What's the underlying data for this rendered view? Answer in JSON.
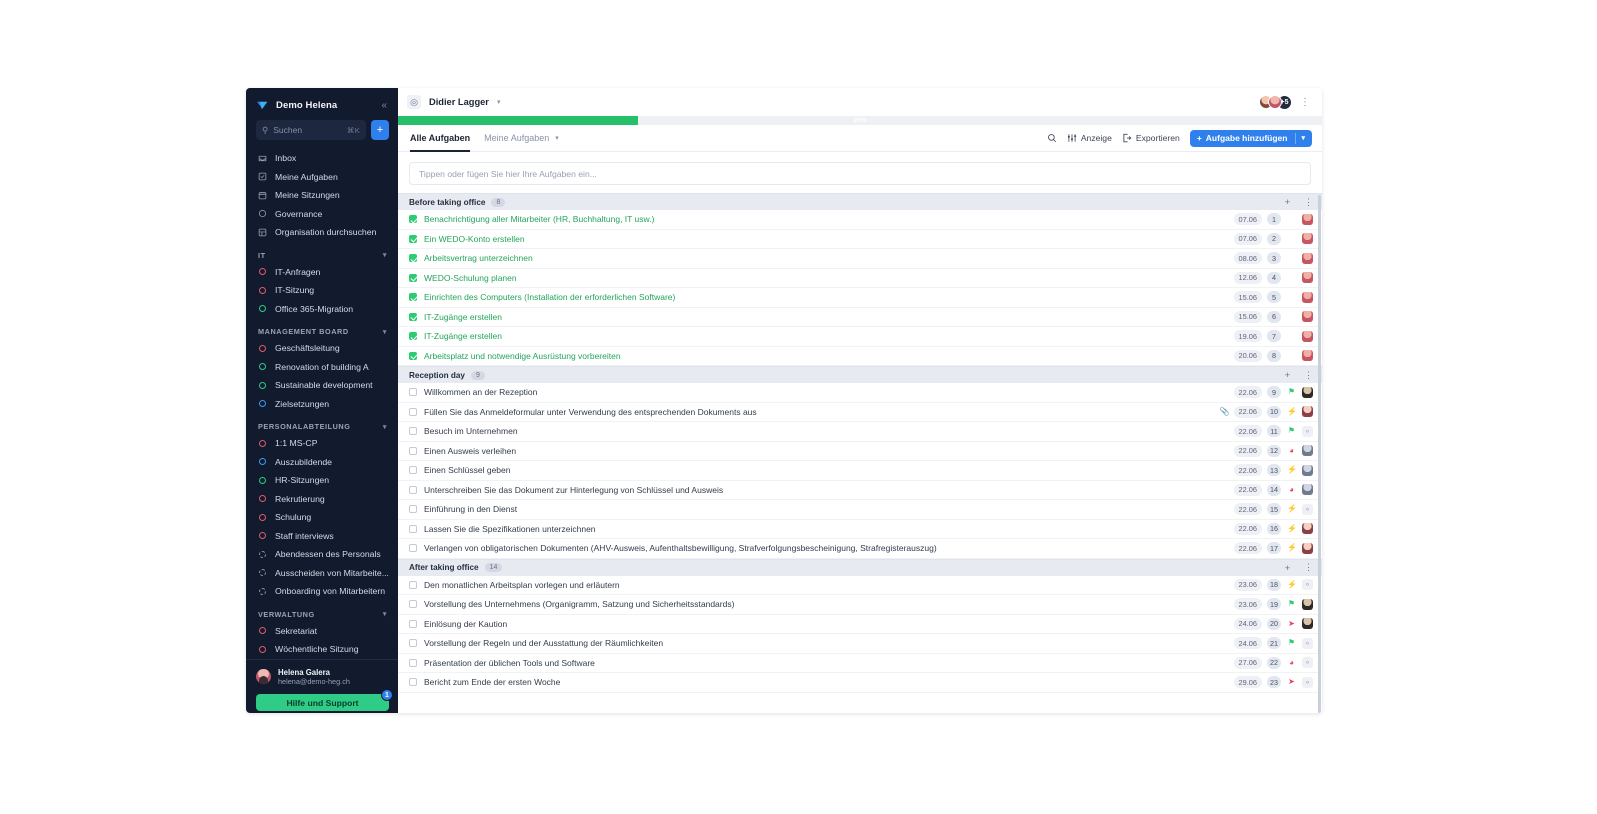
{
  "sidebar": {
    "brand": "Demo Helena",
    "collapse_icon": "chevrons-left-icon",
    "search": {
      "placeholder": "Suchen",
      "shortcut": "⌘K",
      "add_label": "+"
    },
    "nav": [
      {
        "label": "Inbox",
        "icon": "inbox-icon"
      },
      {
        "label": "Meine Aufgaben",
        "icon": "check-square-icon"
      },
      {
        "label": "Meine Sitzungen",
        "icon": "calendar-icon"
      },
      {
        "label": "Governance",
        "icon": "circle-icon"
      },
      {
        "label": "Organisation durchsuchen",
        "icon": "grid-icon"
      }
    ],
    "groups": [
      {
        "title": "IT",
        "items": [
          {
            "label": "IT-Anfragen",
            "color": "#e05a6e",
            "style": "solid"
          },
          {
            "label": "IT-Sitzung",
            "color": "#e05a6e",
            "style": "solid"
          },
          {
            "label": "Office 365-Migration",
            "color": "#2ecc87",
            "style": "solid"
          }
        ]
      },
      {
        "title": "MANAGEMENT BOARD",
        "items": [
          {
            "label": "Geschäftsleitung",
            "color": "#e05a6e",
            "style": "solid"
          },
          {
            "label": "Renovation of building A",
            "color": "#2ecc87",
            "style": "solid"
          },
          {
            "label": "Sustainable development",
            "color": "#2ecc87",
            "style": "solid"
          },
          {
            "label": "Zielsetzungen",
            "color": "#3b9bf0",
            "style": "solid"
          }
        ]
      },
      {
        "title": "PERSONALABTEILUNG",
        "items": [
          {
            "label": "1:1 MS-CP",
            "color": "#e05a6e",
            "style": "solid"
          },
          {
            "label": "Auszubildende",
            "color": "#3b9bf0",
            "style": "solid"
          },
          {
            "label": "HR-Sitzungen",
            "color": "#2ecc87",
            "style": "solid"
          },
          {
            "label": "Rekrutierung",
            "color": "#e05a6e",
            "style": "solid"
          },
          {
            "label": "Schulung",
            "color": "#e05a6e",
            "style": "solid"
          },
          {
            "label": "Staff interviews",
            "color": "#e05a6e",
            "style": "solid"
          },
          {
            "label": "Abendessen des Personals",
            "color": "#8b94a8",
            "style": "dashed"
          },
          {
            "label": "Ausscheiden von Mitarbeite...",
            "color": "#8b94a8",
            "style": "dashed"
          },
          {
            "label": "Onboarding von Mitarbeitern",
            "color": "#8b94a8",
            "style": "dashed"
          }
        ]
      },
      {
        "title": "VERWALTUNG",
        "items": [
          {
            "label": "Sekretariat",
            "color": "#e05a6e",
            "style": "solid"
          },
          {
            "label": "Wöchentliche Sitzung",
            "color": "#e05a6e",
            "style": "solid"
          }
        ]
      }
    ],
    "user": {
      "name": "Helena Galera",
      "email": "helena@demo-heg.ch"
    },
    "help": {
      "label": "Hilfe und Support",
      "badge": "1"
    }
  },
  "topbar": {
    "breadcrumb_icon": "target-icon",
    "breadcrumb": "Didier Lagger",
    "breadcrumb_chevron": "chevron-down-icon",
    "avatar_overflow": "+5",
    "menu_icon": "kebab-menu-icon"
  },
  "progress": {
    "percent_label": "26%",
    "percent": 26,
    "color": "#27c06a"
  },
  "tabs": [
    {
      "label": "Alle Aufgaben",
      "active": true
    },
    {
      "label": "Meine Aufgaben",
      "active": false
    }
  ],
  "toolbar": {
    "search_icon": "search-icon",
    "view_label": "Anzeige",
    "view_icon": "sliders-icon",
    "export_label": "Exportieren",
    "export_icon": "export-icon",
    "add_task_label": "Aufgabe hinzufügen",
    "add_task_plus": "+",
    "add_task_chevron": "chevron-down-icon"
  },
  "quick_add": {
    "placeholder": "Tippen oder fügen Sie hier Ihre Aufgaben ein..."
  },
  "sections": [
    {
      "title": "Before taking office",
      "count": "8",
      "add_icon": "plus-icon",
      "menu_icon": "kebab-menu-icon",
      "rows": [
        {
          "done": true,
          "title": "Benachrichtigung aller Mitarbeiter (HR, Buchhaltung, IT usw.)",
          "due": "07.06",
          "index": "1",
          "priority": "",
          "priority_color": "",
          "avatar": "p1",
          "clip": false
        },
        {
          "done": true,
          "title": "Ein WEDO-Konto erstellen",
          "due": "07.06",
          "index": "2",
          "priority": "",
          "priority_color": "",
          "avatar": "p1",
          "clip": false
        },
        {
          "done": true,
          "title": "Arbeitsvertrag unterzeichnen",
          "due": "08.06",
          "index": "3",
          "priority": "",
          "priority_color": "",
          "avatar": "p1",
          "clip": false
        },
        {
          "done": true,
          "title": "WEDO-Schulung planen",
          "due": "12.06",
          "index": "4",
          "priority": "",
          "priority_color": "",
          "avatar": "p1",
          "clip": false
        },
        {
          "done": true,
          "title": "Einrichten des Computers (Installation der erforderlichen Software)",
          "due": "15.06",
          "index": "5",
          "priority": "",
          "priority_color": "",
          "avatar": "p1",
          "clip": false
        },
        {
          "done": true,
          "title": "IT-Zugänge erstellen",
          "due": "15.06",
          "index": "6",
          "priority": "",
          "priority_color": "",
          "avatar": "p1",
          "clip": false
        },
        {
          "done": true,
          "title": "IT-Zugänge erstellen",
          "due": "19.06",
          "index": "7",
          "priority": "",
          "priority_color": "",
          "avatar": "p1",
          "clip": false
        },
        {
          "done": true,
          "title": "Arbeitsplatz und notwendige Ausrüstung vorbereiten",
          "due": "20.06",
          "index": "8",
          "priority": "",
          "priority_color": "",
          "avatar": "p1",
          "clip": false
        }
      ]
    },
    {
      "title": "Reception day",
      "count": "9",
      "add_icon": "plus-icon",
      "menu_icon": "kebab-menu-icon",
      "rows": [
        {
          "done": false,
          "title": "Willkommen an der Rezeption",
          "due": "22.06",
          "index": "9",
          "priority": "⚑",
          "priority_color": "#2ecc71",
          "avatar": "p5",
          "clip": false
        },
        {
          "done": false,
          "title": "Füllen Sie das Anmeldeformular unter Verwendung des entsprechenden Dokuments aus",
          "due": "22.06",
          "index": "10",
          "priority": "⚡",
          "priority_color": "#e8425a",
          "avatar": "p4",
          "clip": true
        },
        {
          "done": false,
          "title": "Besuch im Unternehmen",
          "due": "22.06",
          "index": "11",
          "priority": "⚑",
          "priority_color": "#2ecc71",
          "avatar": "ph",
          "clip": false
        },
        {
          "done": false,
          "title": "Einen Ausweis verleihen",
          "due": "22.06",
          "index": "12",
          "priority": "◕",
          "priority_color": "#e8425a",
          "avatar": "p3",
          "clip": false
        },
        {
          "done": false,
          "title": "Einen Schlüssel geben",
          "due": "22.06",
          "index": "13",
          "priority": "⚡",
          "priority_color": "#e8425a",
          "avatar": "p3",
          "clip": false
        },
        {
          "done": false,
          "title": "Unterschreiben Sie das Dokument zur Hinterlegung von Schlüssel und Ausweis",
          "due": "22.06",
          "index": "14",
          "priority": "◕",
          "priority_color": "#e8425a",
          "avatar": "p3",
          "clip": false
        },
        {
          "done": false,
          "title": "Einführung in den Dienst",
          "due": "22.06",
          "index": "15",
          "priority": "⚡",
          "priority_color": "#e8425a",
          "avatar": "ph",
          "clip": false
        },
        {
          "done": false,
          "title": "Lassen Sie die Spezifikationen unterzeichnen",
          "due": "22.06",
          "index": "16",
          "priority": "⚡",
          "priority_color": "#e8425a",
          "avatar": "p4",
          "clip": false
        },
        {
          "done": false,
          "title": "Verlangen von obligatorischen Dokumenten (AHV-Ausweis, Aufenthaltsbewilligung, Strafverfolgungsbescheinigung, Strafregisterauszug)",
          "due": "22.06",
          "index": "17",
          "priority": "⚡",
          "priority_color": "#e8425a",
          "avatar": "p4",
          "clip": false
        }
      ]
    },
    {
      "title": "After taking office",
      "count": "14",
      "add_icon": "plus-icon",
      "menu_icon": "kebab-menu-icon",
      "rows": [
        {
          "done": false,
          "title": "Den monatlichen Arbeitsplan vorlegen und erläutern",
          "due": "23.06",
          "index": "18",
          "priority": "⚡",
          "priority_color": "#e8425a",
          "avatar": "ph",
          "clip": false
        },
        {
          "done": false,
          "title": "Vorstellung des Unternehmens (Organigramm, Satzung und Sicherheitsstandards)",
          "due": "23.06",
          "index": "19",
          "priority": "⚑",
          "priority_color": "#2ecc71",
          "avatar": "p5",
          "clip": false
        },
        {
          "done": false,
          "title": "Einlösung der Kaution",
          "due": "24.06",
          "index": "20",
          "priority": "➤",
          "priority_color": "#e8425a",
          "avatar": "p5",
          "clip": false
        },
        {
          "done": false,
          "title": "Vorstellung der Regeln und der Ausstattung der Räumlichkeiten",
          "due": "24.06",
          "index": "21",
          "priority": "⚑",
          "priority_color": "#2ecc71",
          "avatar": "ph",
          "clip": false
        },
        {
          "done": false,
          "title": "Präsentation der üblichen Tools und Software",
          "due": "27.06",
          "index": "22",
          "priority": "◕",
          "priority_color": "#e8425a",
          "avatar": "ph",
          "clip": false
        },
        {
          "done": false,
          "title": "Bericht zum Ende der ersten Woche",
          "due": "29.06",
          "index": "23",
          "priority": "➤",
          "priority_color": "#e8425a",
          "avatar": "ph",
          "clip": false
        }
      ]
    }
  ]
}
